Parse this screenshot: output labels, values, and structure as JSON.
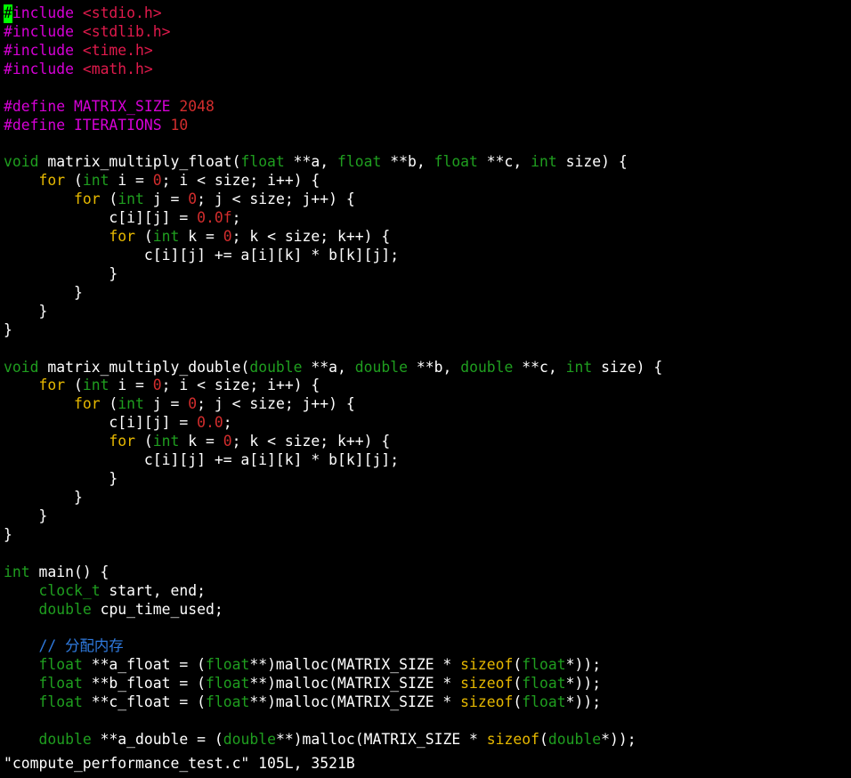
{
  "colors": {
    "background": "#000000",
    "default_text": "#ffffff",
    "preprocessor": "#d600d6",
    "header_string": "#e01a4c",
    "number": "#d22d2d",
    "type": "#1f9e1f",
    "keyword": "#e6b800",
    "comment": "#2f7be0",
    "cursor": "#00ff00"
  },
  "editor": {
    "cursor_char": "#",
    "lines": [
      [
        [
          "include",
          "preprocessor"
        ],
        [
          " ",
          "default_text"
        ],
        [
          "<stdio.h>",
          "header_string"
        ]
      ],
      [
        [
          "#include",
          "preprocessor"
        ],
        [
          " ",
          "default_text"
        ],
        [
          "<stdlib.h>",
          "header_string"
        ]
      ],
      [
        [
          "#include",
          "preprocessor"
        ],
        [
          " ",
          "default_text"
        ],
        [
          "<time.h>",
          "header_string"
        ]
      ],
      [
        [
          "#include",
          "preprocessor"
        ],
        [
          " ",
          "default_text"
        ],
        [
          "<math.h>",
          "header_string"
        ]
      ],
      [],
      [
        [
          "#define MATRIX_SIZE",
          "preprocessor"
        ],
        [
          " ",
          "default_text"
        ],
        [
          "2048",
          "number"
        ]
      ],
      [
        [
          "#define ITERATIONS",
          "preprocessor"
        ],
        [
          " ",
          "default_text"
        ],
        [
          "10",
          "number"
        ]
      ],
      [],
      [
        [
          "void",
          "type"
        ],
        [
          " matrix_multiply_float(",
          "default_text"
        ],
        [
          "float",
          "type"
        ],
        [
          " **a, ",
          "default_text"
        ],
        [
          "float",
          "type"
        ],
        [
          " **b, ",
          "default_text"
        ],
        [
          "float",
          "type"
        ],
        [
          " **c, ",
          "default_text"
        ],
        [
          "int",
          "type"
        ],
        [
          " size) {",
          "default_text"
        ]
      ],
      [
        [
          "    ",
          "default_text"
        ],
        [
          "for",
          "keyword"
        ],
        [
          " (",
          "default_text"
        ],
        [
          "int",
          "type"
        ],
        [
          " i = ",
          "default_text"
        ],
        [
          "0",
          "number"
        ],
        [
          "; i < size; i++) {",
          "default_text"
        ]
      ],
      [
        [
          "        ",
          "default_text"
        ],
        [
          "for",
          "keyword"
        ],
        [
          " (",
          "default_text"
        ],
        [
          "int",
          "type"
        ],
        [
          " j = ",
          "default_text"
        ],
        [
          "0",
          "number"
        ],
        [
          "; j < size; j++) {",
          "default_text"
        ]
      ],
      [
        [
          "            c[i][j] = ",
          "default_text"
        ],
        [
          "0.0f",
          "number"
        ],
        [
          ";",
          "default_text"
        ]
      ],
      [
        [
          "            ",
          "default_text"
        ],
        [
          "for",
          "keyword"
        ],
        [
          " (",
          "default_text"
        ],
        [
          "int",
          "type"
        ],
        [
          " k = ",
          "default_text"
        ],
        [
          "0",
          "number"
        ],
        [
          "; k < size; k++) {",
          "default_text"
        ]
      ],
      [
        [
          "                c[i][j] += a[i][k] * b[k][j];",
          "default_text"
        ]
      ],
      [
        [
          "            }",
          "default_text"
        ]
      ],
      [
        [
          "        }",
          "default_text"
        ]
      ],
      [
        [
          "    }",
          "default_text"
        ]
      ],
      [
        [
          "}",
          "default_text"
        ]
      ],
      [],
      [
        [
          "void",
          "type"
        ],
        [
          " matrix_multiply_double(",
          "default_text"
        ],
        [
          "double",
          "type"
        ],
        [
          " **a, ",
          "default_text"
        ],
        [
          "double",
          "type"
        ],
        [
          " **b, ",
          "default_text"
        ],
        [
          "double",
          "type"
        ],
        [
          " **c, ",
          "default_text"
        ],
        [
          "int",
          "type"
        ],
        [
          " size) {",
          "default_text"
        ]
      ],
      [
        [
          "    ",
          "default_text"
        ],
        [
          "for",
          "keyword"
        ],
        [
          " (",
          "default_text"
        ],
        [
          "int",
          "type"
        ],
        [
          " i = ",
          "default_text"
        ],
        [
          "0",
          "number"
        ],
        [
          "; i < size; i++) {",
          "default_text"
        ]
      ],
      [
        [
          "        ",
          "default_text"
        ],
        [
          "for",
          "keyword"
        ],
        [
          " (",
          "default_text"
        ],
        [
          "int",
          "type"
        ],
        [
          " j = ",
          "default_text"
        ],
        [
          "0",
          "number"
        ],
        [
          "; j < size; j++) {",
          "default_text"
        ]
      ],
      [
        [
          "            c[i][j] = ",
          "default_text"
        ],
        [
          "0.0",
          "number"
        ],
        [
          ";",
          "default_text"
        ]
      ],
      [
        [
          "            ",
          "default_text"
        ],
        [
          "for",
          "keyword"
        ],
        [
          " (",
          "default_text"
        ],
        [
          "int",
          "type"
        ],
        [
          " k = ",
          "default_text"
        ],
        [
          "0",
          "number"
        ],
        [
          "; k < size; k++) {",
          "default_text"
        ]
      ],
      [
        [
          "                c[i][j] += a[i][k] * b[k][j];",
          "default_text"
        ]
      ],
      [
        [
          "            }",
          "default_text"
        ]
      ],
      [
        [
          "        }",
          "default_text"
        ]
      ],
      [
        [
          "    }",
          "default_text"
        ]
      ],
      [
        [
          "}",
          "default_text"
        ]
      ],
      [],
      [
        [
          "int",
          "type"
        ],
        [
          " main() {",
          "default_text"
        ]
      ],
      [
        [
          "    ",
          "default_text"
        ],
        [
          "clock_t",
          "type"
        ],
        [
          " start, end;",
          "default_text"
        ]
      ],
      [
        [
          "    ",
          "default_text"
        ],
        [
          "double",
          "type"
        ],
        [
          " cpu_time_used;",
          "default_text"
        ]
      ],
      [],
      [
        [
          "    ",
          "default_text"
        ],
        [
          "// 分配内存",
          "comment"
        ]
      ],
      [
        [
          "    ",
          "default_text"
        ],
        [
          "float",
          "type"
        ],
        [
          " **a_float = (",
          "default_text"
        ],
        [
          "float",
          "type"
        ],
        [
          "**)malloc(MATRIX_SIZE * ",
          "default_text"
        ],
        [
          "sizeof",
          "keyword"
        ],
        [
          "(",
          "default_text"
        ],
        [
          "float",
          "type"
        ],
        [
          "*));",
          "default_text"
        ]
      ],
      [
        [
          "    ",
          "default_text"
        ],
        [
          "float",
          "type"
        ],
        [
          " **b_float = (",
          "default_text"
        ],
        [
          "float",
          "type"
        ],
        [
          "**)malloc(MATRIX_SIZE * ",
          "default_text"
        ],
        [
          "sizeof",
          "keyword"
        ],
        [
          "(",
          "default_text"
        ],
        [
          "float",
          "type"
        ],
        [
          "*));",
          "default_text"
        ]
      ],
      [
        [
          "    ",
          "default_text"
        ],
        [
          "float",
          "type"
        ],
        [
          " **c_float = (",
          "default_text"
        ],
        [
          "float",
          "type"
        ],
        [
          "**)malloc(MATRIX_SIZE * ",
          "default_text"
        ],
        [
          "sizeof",
          "keyword"
        ],
        [
          "(",
          "default_text"
        ],
        [
          "float",
          "type"
        ],
        [
          "*));",
          "default_text"
        ]
      ],
      [],
      [
        [
          "    ",
          "default_text"
        ],
        [
          "double",
          "type"
        ],
        [
          " **a_double = (",
          "default_text"
        ],
        [
          "double",
          "type"
        ],
        [
          "**)malloc(MATRIX_SIZE * ",
          "default_text"
        ],
        [
          "sizeof",
          "keyword"
        ],
        [
          "(",
          "default_text"
        ],
        [
          "double",
          "type"
        ],
        [
          "*));",
          "default_text"
        ]
      ]
    ]
  },
  "status_line": {
    "text": "\"compute_performance_test.c\" 105L, 3521B"
  }
}
